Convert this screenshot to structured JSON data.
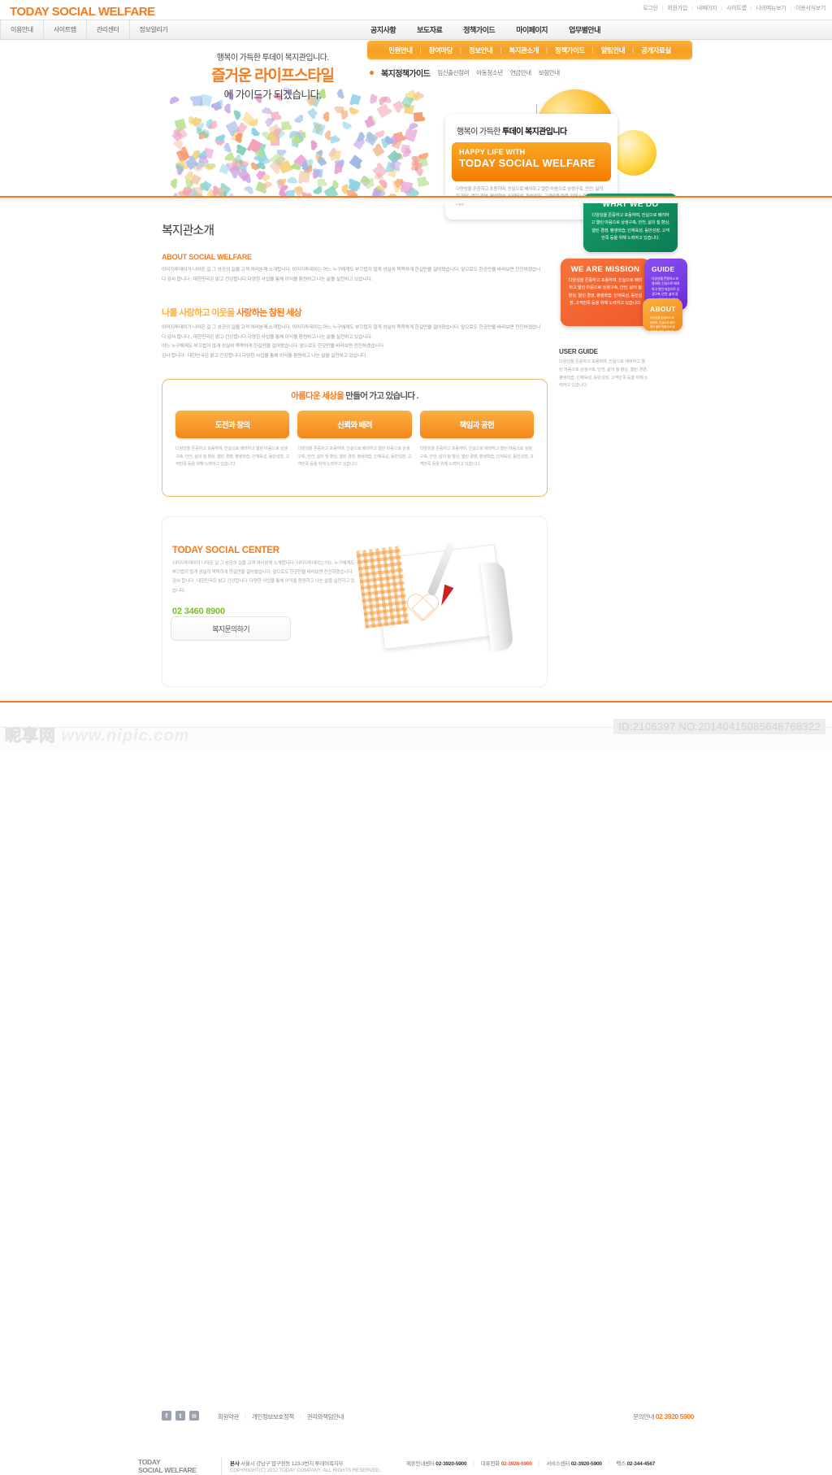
{
  "site": {
    "brand": "TODAY SOCIAL WELFARE",
    "accent": "#f47b20",
    "green": "#7dbd2e"
  },
  "utility": {
    "links": [
      "로그인",
      "회원가입",
      "내페이지",
      "사이트맵",
      "나의메뉴보기",
      "이용서식보기"
    ]
  },
  "gnb": {
    "left_items": [
      "이용안내",
      "사이트맵",
      "관리센터",
      "정보알리기"
    ],
    "main_items": [
      "공지사항",
      "보도자료",
      "정책가이드",
      "마이페이지",
      "업무별안내"
    ]
  },
  "subnav": {
    "items": [
      "민원안내",
      "참여마당",
      "정보안내",
      "복지관소개",
      "정책가이드",
      "알림안내",
      "공개자료실"
    ]
  },
  "thirdnav": {
    "current": "복지정책가이드",
    "items": [
      "임신출산장려",
      "아동청소년",
      "연금안내",
      "보험안내"
    ]
  },
  "hero": {
    "line1": "행복이 가득한 투데이 복지관입니다.",
    "line2": "즐거운 라이프스타일",
    "line3": "에 가이드가 되겠습니다.",
    "card": {
      "title_plain": "행복이 가득한 ",
      "title_bold": "투데이 복지관입니다",
      "en_small": "HAPPY LIFE WITH",
      "en_big": "TODAY SOCIAL WELFARE",
      "desc": "다양성을 존중하고 포용하며, 진실으로 배려하고 열린 마음으로 상생구축, 안전, 삶의 질 향상, 열린 경영, 평생학습, 인재육성, 동반성장, 고객만족 등을 위해 노력하고 있습니다."
    }
  },
  "boxes": [
    {
      "id": "whatwedo",
      "heading": "WHAT WE DO",
      "body": "다양성을 존중하고 포용하며, 진실으로 배려하고 열린 마음으로 상생구축, 안전, 삶의 질 향상, 열린 경영, 평생학습, 인재육성, 동반성장, 고객만족 등을 위해 노력하고 있습니다.",
      "color": "#0c7b54"
    },
    {
      "id": "mission",
      "heading": "WE ARE MISSION",
      "body": "다양성을 존중하고 포용하며, 진실으로 배려하고 열린 마음으로 상생구축, 안전, 삶의 질 향상, 열린 경영, 평생학습, 인재육성, 동반성장, 고객만족 등을 위해 노력하고 있습니다.",
      "color": "#ef5a2a"
    },
    {
      "id": "guide",
      "heading": "GUIDE",
      "body": "다양성을 존중하고 포용하며, 진실으로 배려하고 열린 마음으로 상생구축, 안전, 삶의 질 향상, 열린 경영, 평생학습, 인재육성.",
      "color": "#6c2bd9"
    },
    {
      "id": "about",
      "heading": "ABOUT",
      "body": "다양성을 존중하고 포용하며, 진실으로 배려하고 열린 마음으로 상생구축, 안전, 삶의 질 향상, 열린 경영.",
      "color": "#f08a1d"
    }
  ],
  "main": {
    "page_title": "복지관소개",
    "section1": {
      "heading_en": "ABOUT SOCIAL WELFARE",
      "body": "이미지투데이가 나아온 길 그 성공의 길을 고객 여러분께 소개합니다. 이미지투데이는 어느 누구에게도  부끄럽지 않게 성실히 묵묵하게 한길만을 걸어왔습니다. 앞으로도 한곳만을 바라보면 전진하겠습니다 감사 합니다 . 대한민국은 밝고 건강합니다.다양한 사업을 통해 이익을 환원하고 나눈 삶을 실천하고 있습니다."
    },
    "section2": {
      "heading_light": "나를 사랑하고 이웃을 ",
      "heading_bold": "사랑하는 참된 세상",
      "body": "이미지투데이가 나아온 길 그 성공의 길을 고객 여러분께 소개합니다. 이미지투데이는 어느 누구에게도  부끄럽지 않게 성실히 묵묵하게 한길만을 걸어왔습니다. 앞으로도 한곳만을 바라보면 전진하겠습니다 감사 합니다 , 대한민국은 밝고 건강합니다.다양한 사업을 통해 이익을 환원하고 나눈 삶을 실천하고 있습니다.\n어느 누구에게도  부끄럽지 않게 성실히 묵묵하게 한길만을 걸어왔습니다. 앞으로도 한곳만을 바라보면 전진하겠습니다\n감사 합니다 . 대한민국은 밝고 건강합니다.다양한 사업을 통해 이익을 환원하고 나눈 삶을 실천하고 있습니다."
    },
    "value_card": {
      "title_bold": "아름다운 세상을",
      "title_rest": " 만들어 가고 있습니다 .",
      "buttons": [
        "도전과 창의",
        "신뢰와 배려",
        "책임과 공헌"
      ],
      "descs": [
        "다양성을 존중하고 포용하며, 진실으로 배려하고 열린 마음으로 상생구축, 안전, 삶의 질 향상, 열린 경영, 평생학습, 인재육성, 동반성장, 고객만족 등을 위해 노력하고 있습니다.",
        "다양성을 존중하고 포용하며, 진실으로 배려하고 열린 마음으로 상생구축, 안전, 삶의 질 향상, 열린 경영, 평생학습, 인재육성, 동반성장, 고객만족 등을 위해 노력하고 있습니다.",
        "다양성을 존중하고 포용하며, 진실으로 배려하고 열린 마음으로 상생구축, 안전, 삶의 질 향상, 열린 경영, 평생학습, 인재육성, 동반성장, 고객만족 등을 위해 노력하고 있습니다."
      ]
    },
    "user_guide": {
      "heading": "USER GUIDE",
      "body": "다양성을 존중하고 포용하며, 진실으로 배려하고 열린 마음으로 상생구축, 안전, 삶의 질 향상, 열린 경영, 평생학습, 인재육성, 동반성장, 고객만족 등을 위해 노력하고 있습니다."
    },
    "center": {
      "title": "TODAY SOCIAL CENTER",
      "body": "이미지투데이가 나아온 길 그 성공의 길을 고객 여러분께 소개합니다. 이미지투데이는 어느 누구에게도  부끄럽지 않게 성실히 묵묵하게 한길만을 걸어왔습니다. 앞으로도 한곳만을 바라보면 전진하겠습니다 감사 합니다 , 대한민국은 밝고 건강합니다. 다양한 사업을 통해 이익을 환원하고 나눈 삶을 실천하고 있습니다.",
      "phone": "02 3460 8900",
      "button": "복지문의하기"
    }
  },
  "footer": {
    "sns": [
      "facebook-icon",
      "twitter-icon",
      "youtube-icon"
    ],
    "sns_glyphs": [
      "f",
      "t",
      "▤"
    ],
    "links": [
      "회원약관",
      "개인정보보호정책",
      "권리와책임안내"
    ],
    "contact_label": "문의안내",
    "contact_phone": "02 3920 5900",
    "logo_line1": "TODAY",
    "logo_line2": "SOCIAL WELFARE",
    "address_label": "본사",
    "address": "서울시 강남구 압구정동 123-3번지  투데이복지부",
    "copyright": "COPYRIGHT(C) 2012 TODAY COMPANY.  ALL RIGHTS RESERVED.",
    "info": [
      {
        "label": "제휴안내센터",
        "value": "02-3920-5900",
        "red": false
      },
      {
        "label": "대표전화",
        "value": "02-3920-5900",
        "red": true
      },
      {
        "label": "서비스센터",
        "value": "02-3920-5900",
        "red": false
      },
      {
        "label": "팩스",
        "value": "02-344-4567",
        "red": false
      }
    ]
  },
  "watermarks": {
    "id_tag": "ID:2106397 NO:20140415085648768322",
    "nipic_cn": "昵享网",
    "nipic_url": "www.nipic.com"
  }
}
